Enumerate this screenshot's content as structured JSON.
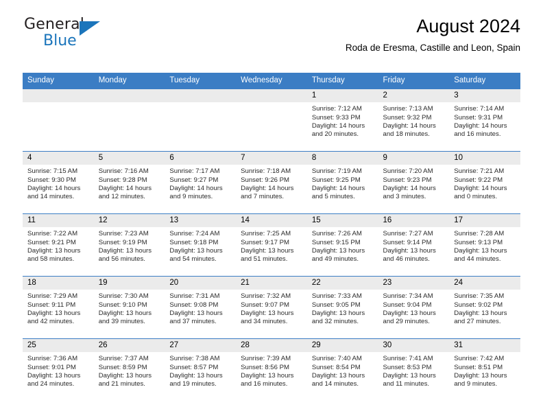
{
  "brand": {
    "name_part1": "General",
    "name_part2": "Blue",
    "logo_icon": "triangle-flag-icon"
  },
  "header": {
    "title": "August 2024",
    "subtitle": "Roda de Eresma, Castille and Leon, Spain"
  },
  "colors": {
    "header_band": "#3b7dc4",
    "daynum_band": "#ebebeb",
    "brand_blue": "#1b75bb",
    "cell_background": "#ffffff"
  },
  "calendar": {
    "weekday_headers": [
      "Sunday",
      "Monday",
      "Tuesday",
      "Wednesday",
      "Thursday",
      "Friday",
      "Saturday"
    ],
    "weeks": [
      [
        {
          "day": "",
          "text": ""
        },
        {
          "day": "",
          "text": ""
        },
        {
          "day": "",
          "text": ""
        },
        {
          "day": "",
          "text": ""
        },
        {
          "day": "1",
          "text": "Sunrise: 7:12 AM\nSunset: 9:33 PM\nDaylight: 14 hours\nand 20 minutes."
        },
        {
          "day": "2",
          "text": "Sunrise: 7:13 AM\nSunset: 9:32 PM\nDaylight: 14 hours\nand 18 minutes."
        },
        {
          "day": "3",
          "text": "Sunrise: 7:14 AM\nSunset: 9:31 PM\nDaylight: 14 hours\nand 16 minutes."
        }
      ],
      [
        {
          "day": "4",
          "text": "Sunrise: 7:15 AM\nSunset: 9:30 PM\nDaylight: 14 hours\nand 14 minutes."
        },
        {
          "day": "5",
          "text": "Sunrise: 7:16 AM\nSunset: 9:28 PM\nDaylight: 14 hours\nand 12 minutes."
        },
        {
          "day": "6",
          "text": "Sunrise: 7:17 AM\nSunset: 9:27 PM\nDaylight: 14 hours\nand 9 minutes."
        },
        {
          "day": "7",
          "text": "Sunrise: 7:18 AM\nSunset: 9:26 PM\nDaylight: 14 hours\nand 7 minutes."
        },
        {
          "day": "8",
          "text": "Sunrise: 7:19 AM\nSunset: 9:25 PM\nDaylight: 14 hours\nand 5 minutes."
        },
        {
          "day": "9",
          "text": "Sunrise: 7:20 AM\nSunset: 9:23 PM\nDaylight: 14 hours\nand 3 minutes."
        },
        {
          "day": "10",
          "text": "Sunrise: 7:21 AM\nSunset: 9:22 PM\nDaylight: 14 hours\nand 0 minutes."
        }
      ],
      [
        {
          "day": "11",
          "text": "Sunrise: 7:22 AM\nSunset: 9:21 PM\nDaylight: 13 hours\nand 58 minutes."
        },
        {
          "day": "12",
          "text": "Sunrise: 7:23 AM\nSunset: 9:19 PM\nDaylight: 13 hours\nand 56 minutes."
        },
        {
          "day": "13",
          "text": "Sunrise: 7:24 AM\nSunset: 9:18 PM\nDaylight: 13 hours\nand 54 minutes."
        },
        {
          "day": "14",
          "text": "Sunrise: 7:25 AM\nSunset: 9:17 PM\nDaylight: 13 hours\nand 51 minutes."
        },
        {
          "day": "15",
          "text": "Sunrise: 7:26 AM\nSunset: 9:15 PM\nDaylight: 13 hours\nand 49 minutes."
        },
        {
          "day": "16",
          "text": "Sunrise: 7:27 AM\nSunset: 9:14 PM\nDaylight: 13 hours\nand 46 minutes."
        },
        {
          "day": "17",
          "text": "Sunrise: 7:28 AM\nSunset: 9:13 PM\nDaylight: 13 hours\nand 44 minutes."
        }
      ],
      [
        {
          "day": "18",
          "text": "Sunrise: 7:29 AM\nSunset: 9:11 PM\nDaylight: 13 hours\nand 42 minutes."
        },
        {
          "day": "19",
          "text": "Sunrise: 7:30 AM\nSunset: 9:10 PM\nDaylight: 13 hours\nand 39 minutes."
        },
        {
          "day": "20",
          "text": "Sunrise: 7:31 AM\nSunset: 9:08 PM\nDaylight: 13 hours\nand 37 minutes."
        },
        {
          "day": "21",
          "text": "Sunrise: 7:32 AM\nSunset: 9:07 PM\nDaylight: 13 hours\nand 34 minutes."
        },
        {
          "day": "22",
          "text": "Sunrise: 7:33 AM\nSunset: 9:05 PM\nDaylight: 13 hours\nand 32 minutes."
        },
        {
          "day": "23",
          "text": "Sunrise: 7:34 AM\nSunset: 9:04 PM\nDaylight: 13 hours\nand 29 minutes."
        },
        {
          "day": "24",
          "text": "Sunrise: 7:35 AM\nSunset: 9:02 PM\nDaylight: 13 hours\nand 27 minutes."
        }
      ],
      [
        {
          "day": "25",
          "text": "Sunrise: 7:36 AM\nSunset: 9:01 PM\nDaylight: 13 hours\nand 24 minutes."
        },
        {
          "day": "26",
          "text": "Sunrise: 7:37 AM\nSunset: 8:59 PM\nDaylight: 13 hours\nand 21 minutes."
        },
        {
          "day": "27",
          "text": "Sunrise: 7:38 AM\nSunset: 8:57 PM\nDaylight: 13 hours\nand 19 minutes."
        },
        {
          "day": "28",
          "text": "Sunrise: 7:39 AM\nSunset: 8:56 PM\nDaylight: 13 hours\nand 16 minutes."
        },
        {
          "day": "29",
          "text": "Sunrise: 7:40 AM\nSunset: 8:54 PM\nDaylight: 13 hours\nand 14 minutes."
        },
        {
          "day": "30",
          "text": "Sunrise: 7:41 AM\nSunset: 8:53 PM\nDaylight: 13 hours\nand 11 minutes."
        },
        {
          "day": "31",
          "text": "Sunrise: 7:42 AM\nSunset: 8:51 PM\nDaylight: 13 hours\nand 9 minutes."
        }
      ]
    ]
  }
}
